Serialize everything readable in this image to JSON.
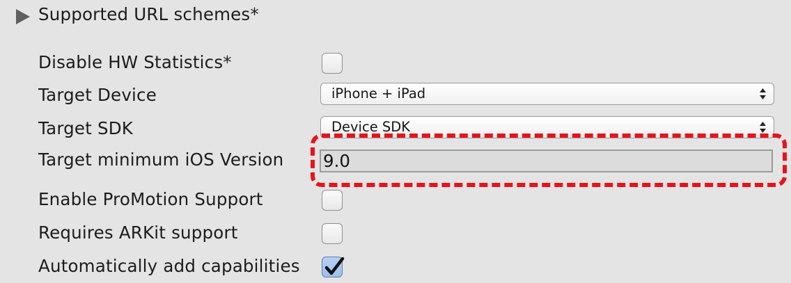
{
  "settings": {
    "supported_url_schemes": {
      "label": "Supported URL schemes*"
    },
    "disable_hw_statistics": {
      "label": "Disable HW Statistics*",
      "checked": false
    },
    "target_device": {
      "label": "Target Device",
      "value": "iPhone + iPad"
    },
    "target_sdk": {
      "label": "Target SDK",
      "value": "Device SDK"
    },
    "target_min_ios": {
      "label": "Target minimum iOS Version",
      "value": "9.0"
    },
    "enable_promotion": {
      "label": "Enable ProMotion Support",
      "checked": false
    },
    "requires_arkit": {
      "label": "Requires ARKit support",
      "checked": false
    },
    "auto_capabilities": {
      "label": "Automatically add capabilities",
      "checked": true
    }
  },
  "colors": {
    "background": "#e4e4e4",
    "highlight": "#e8131a",
    "checkbox_checked": "#9ec0eb"
  },
  "icons": {
    "foldout": "triangle-right-icon",
    "popup": "updown-arrows-icon",
    "check": "checkmark-icon"
  }
}
